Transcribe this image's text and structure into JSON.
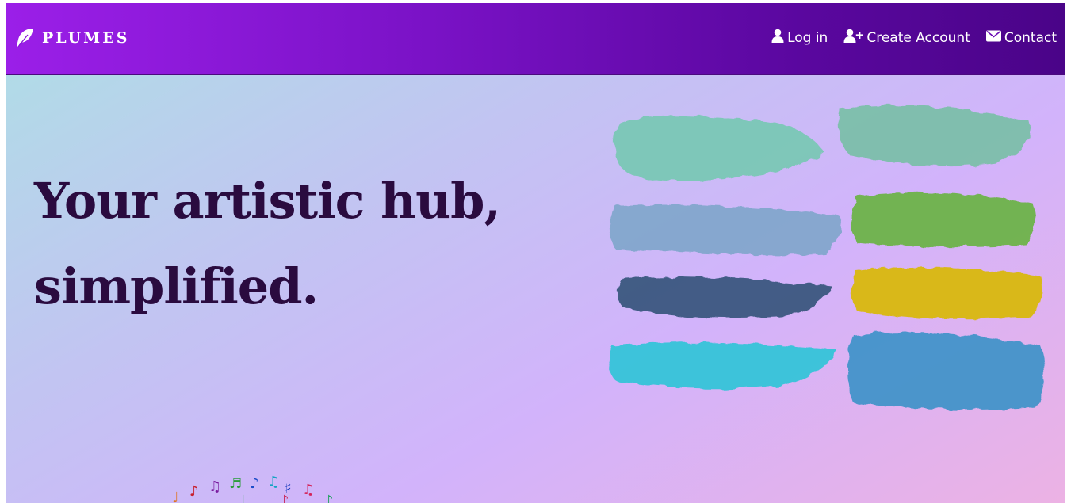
{
  "brand": {
    "name": "PLUMES",
    "icon": "feather-icon"
  },
  "nav": {
    "items": [
      {
        "label": "Log in",
        "icon": "user-icon"
      },
      {
        "label": "Create Account",
        "icon": "user-plus-icon"
      },
      {
        "label": "Contact",
        "icon": "envelope-icon"
      }
    ]
  },
  "hero": {
    "headline_line1": "Your artistic hub,",
    "headline_line2": "simplified."
  },
  "colors": {
    "nav_start": "#9b1fe8",
    "nav_end": "#4a0488",
    "headline": "#2a0b3f",
    "stroke_mint": "#74c8b0",
    "stroke_teal": "#6fbf9e",
    "stroke_slate": "#7aa4c8",
    "stroke_green": "#6eb34a",
    "stroke_navy": "#284d72",
    "stroke_yellow": "#d9b812",
    "stroke_cyan": "#32c4d8",
    "stroke_blue": "#3a92c8"
  }
}
